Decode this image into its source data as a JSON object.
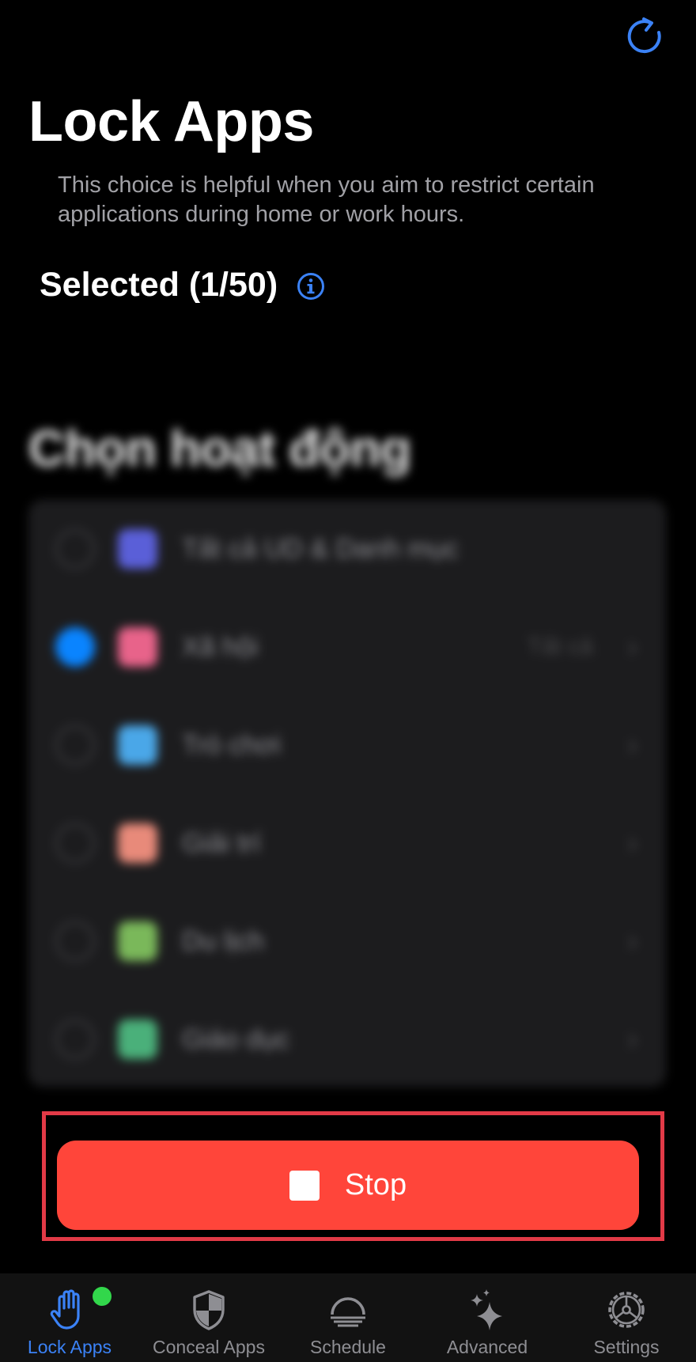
{
  "header": {
    "title": "Lock Apps",
    "subtitle": "This choice is helpful when you aim to restrict certain applications during home or work hours.",
    "selected_label": "Selected (1/50)",
    "refresh_icon": "refresh-icon",
    "info_icon": "info-icon"
  },
  "picker": {
    "title": "Chọn hoạt động",
    "rows": [
      {
        "label": "Tất cả UD & Danh mục",
        "checked": false,
        "detail": "",
        "chevron": false,
        "icon_color": "#5a5fd8"
      },
      {
        "label": "Xã hội",
        "checked": true,
        "detail": "Tất cả",
        "chevron": true,
        "icon_color": "#e8638a"
      },
      {
        "label": "Trò chơi",
        "checked": false,
        "detail": "",
        "chevron": true,
        "icon_color": "#4aa7e8"
      },
      {
        "label": "Giải trí",
        "checked": false,
        "detail": "",
        "chevron": true,
        "icon_color": "#e88a7a"
      },
      {
        "label": "Du lịch",
        "checked": false,
        "detail": "",
        "chevron": true,
        "icon_color": "#7ab85a"
      },
      {
        "label": "Giáo dục",
        "checked": false,
        "detail": "",
        "chevron": true,
        "icon_color": "#4ab07a"
      }
    ],
    "chevron_glyph": "›"
  },
  "action": {
    "stop_label": "Stop",
    "stop_icon": "stop-square-icon",
    "color": "#ff453a",
    "highlight_color": "#e23a47"
  },
  "tabs": [
    {
      "label": "Lock Apps",
      "icon": "hand-icon",
      "active": true,
      "badge": true
    },
    {
      "label": "Conceal Apps",
      "icon": "shield-icon",
      "active": false,
      "badge": false
    },
    {
      "label": "Schedule",
      "icon": "sunset-icon",
      "active": false,
      "badge": false
    },
    {
      "label": "Advanced",
      "icon": "sparkles-icon",
      "active": false,
      "badge": false
    },
    {
      "label": "Settings",
      "icon": "gear-icon",
      "active": false,
      "badge": false
    }
  ],
  "colors": {
    "accent": "#3b82f6",
    "badge": "#32d74b",
    "background": "#000000"
  }
}
